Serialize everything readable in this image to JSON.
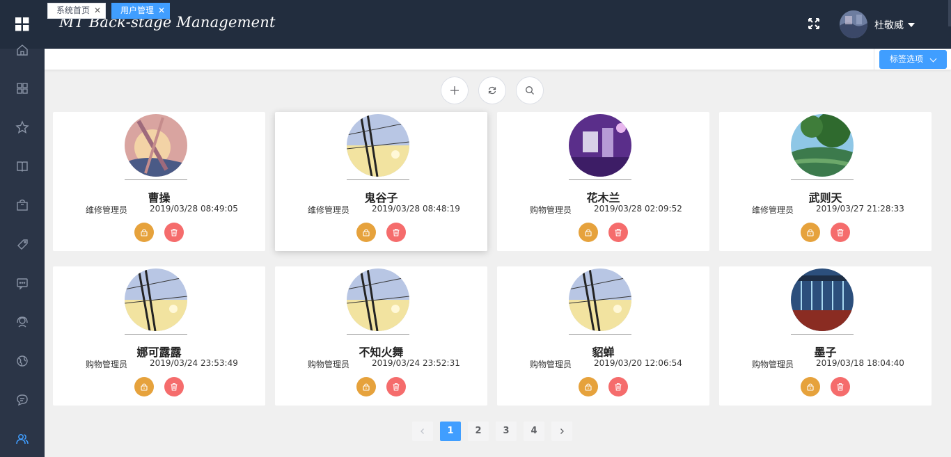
{
  "header": {
    "title": "MT Back-stage Management",
    "user_name": "杜敬威"
  },
  "sidebar": {
    "items": [
      {
        "icon": "home-icon"
      },
      {
        "icon": "dashboard-icon"
      },
      {
        "icon": "star-icon"
      },
      {
        "icon": "book-icon"
      },
      {
        "icon": "bag-icon"
      },
      {
        "icon": "tag-icon"
      },
      {
        "icon": "message-icon"
      },
      {
        "icon": "headset-icon"
      },
      {
        "icon": "globe-icon"
      },
      {
        "icon": "chat-icon"
      },
      {
        "icon": "users-icon",
        "active": true
      }
    ],
    "active_color": "#409eff"
  },
  "tabs": [
    {
      "label": "系统首页",
      "active": false
    },
    {
      "label": "用户管理",
      "active": true
    }
  ],
  "tab_options_label": "标签选项",
  "toolbar": {
    "buttons": [
      "plus-icon",
      "refresh-icon",
      "search-icon"
    ]
  },
  "users": [
    {
      "name": "曹操",
      "role": "维修管理员",
      "time": "2019/03/28 08:49:05"
    },
    {
      "name": "鬼谷子",
      "role": "维修管理员",
      "time": "2019/03/28 08:48:19"
    },
    {
      "name": "花木兰",
      "role": "购物管理员",
      "time": "2019/03/28 02:09:52"
    },
    {
      "name": "武则天",
      "role": "维修管理员",
      "time": "2019/03/27 21:28:33"
    },
    {
      "name": "娜可露露",
      "role": "购物管理员",
      "time": "2019/03/24 23:53:49"
    },
    {
      "name": "不知火舞",
      "role": "购物管理员",
      "time": "2019/03/24 23:52:31"
    },
    {
      "name": "貂蝉",
      "role": "购物管理员",
      "time": "2019/03/20 12:06:54"
    },
    {
      "name": "墨子",
      "role": "购物管理员",
      "time": "2019/03/18 18:04:40"
    }
  ],
  "pagination": {
    "pages": [
      "1",
      "2",
      "3",
      "4"
    ],
    "current": "1"
  },
  "colors": {
    "header_bg": "#222d3e",
    "sidebar_bg": "#2b3547",
    "primary": "#409eff",
    "lock_button": "#e6a23c",
    "delete_button": "#f56c6c"
  }
}
